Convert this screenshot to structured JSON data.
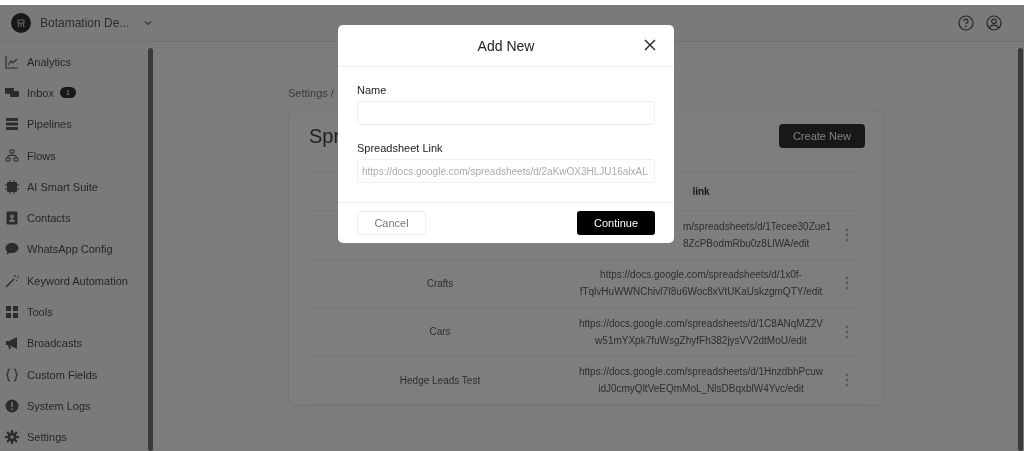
{
  "header": {
    "workspace": "Botamation De..."
  },
  "sidebar": {
    "items": [
      {
        "label": "Analytics"
      },
      {
        "label": "Inbox",
        "badge": "1"
      },
      {
        "label": "Pipelines"
      },
      {
        "label": "Flows"
      },
      {
        "label": "AI Smart Suite"
      },
      {
        "label": "Contacts"
      },
      {
        "label": "WhatsApp Config"
      },
      {
        "label": "Keyword Automation"
      },
      {
        "label": "Tools"
      },
      {
        "label": "Broadcasts"
      },
      {
        "label": "Custom Fields"
      },
      {
        "label": "System Logs"
      },
      {
        "label": "Settings"
      }
    ]
  },
  "breadcrumb": [
    "Settings /"
  ],
  "page": {
    "title": "Spr",
    "create_button": "Create New"
  },
  "table": {
    "columns": [
      "link"
    ],
    "rows": [
      {
        "link": [
          "m/spreadsheets/d/1Tecee30Zue1",
          "8ZcPBodmRbu0z8LlWA/edit"
        ]
      },
      {
        "name": "Crafts",
        "link": [
          "https://docs.google.com/spreadsheets/d/1x0f-",
          "fTqlvHuWWNChivl7I8u6Woc8xVtUKaUskzgmQTY/edit"
        ]
      },
      {
        "name": "Cars",
        "link": [
          "https://docs.google.com/spreadsheets/d/1C8ANqMZ2V",
          "w51mYXpk7fuWsgZhyfFh382jysVV2dtMoU/edit"
        ]
      },
      {
        "name": "Hedge Leads Test",
        "link": [
          "https://docs.google.com/spreadsheets/d/1HnzdbhPcuw",
          "idJ0cmyQltVeEQmMoL_NlsDBqxblW4Yvc/edit"
        ]
      }
    ]
  },
  "modal": {
    "title": "Add New",
    "fields": [
      {
        "label": "Name"
      },
      {
        "label": "Spreadsheet Link",
        "placeholder": "https://docs.google.com/spreadsheets/d/2aKwOX3HLJU16alxAL"
      }
    ],
    "cancel": "Cancel",
    "continue": "Continue"
  }
}
